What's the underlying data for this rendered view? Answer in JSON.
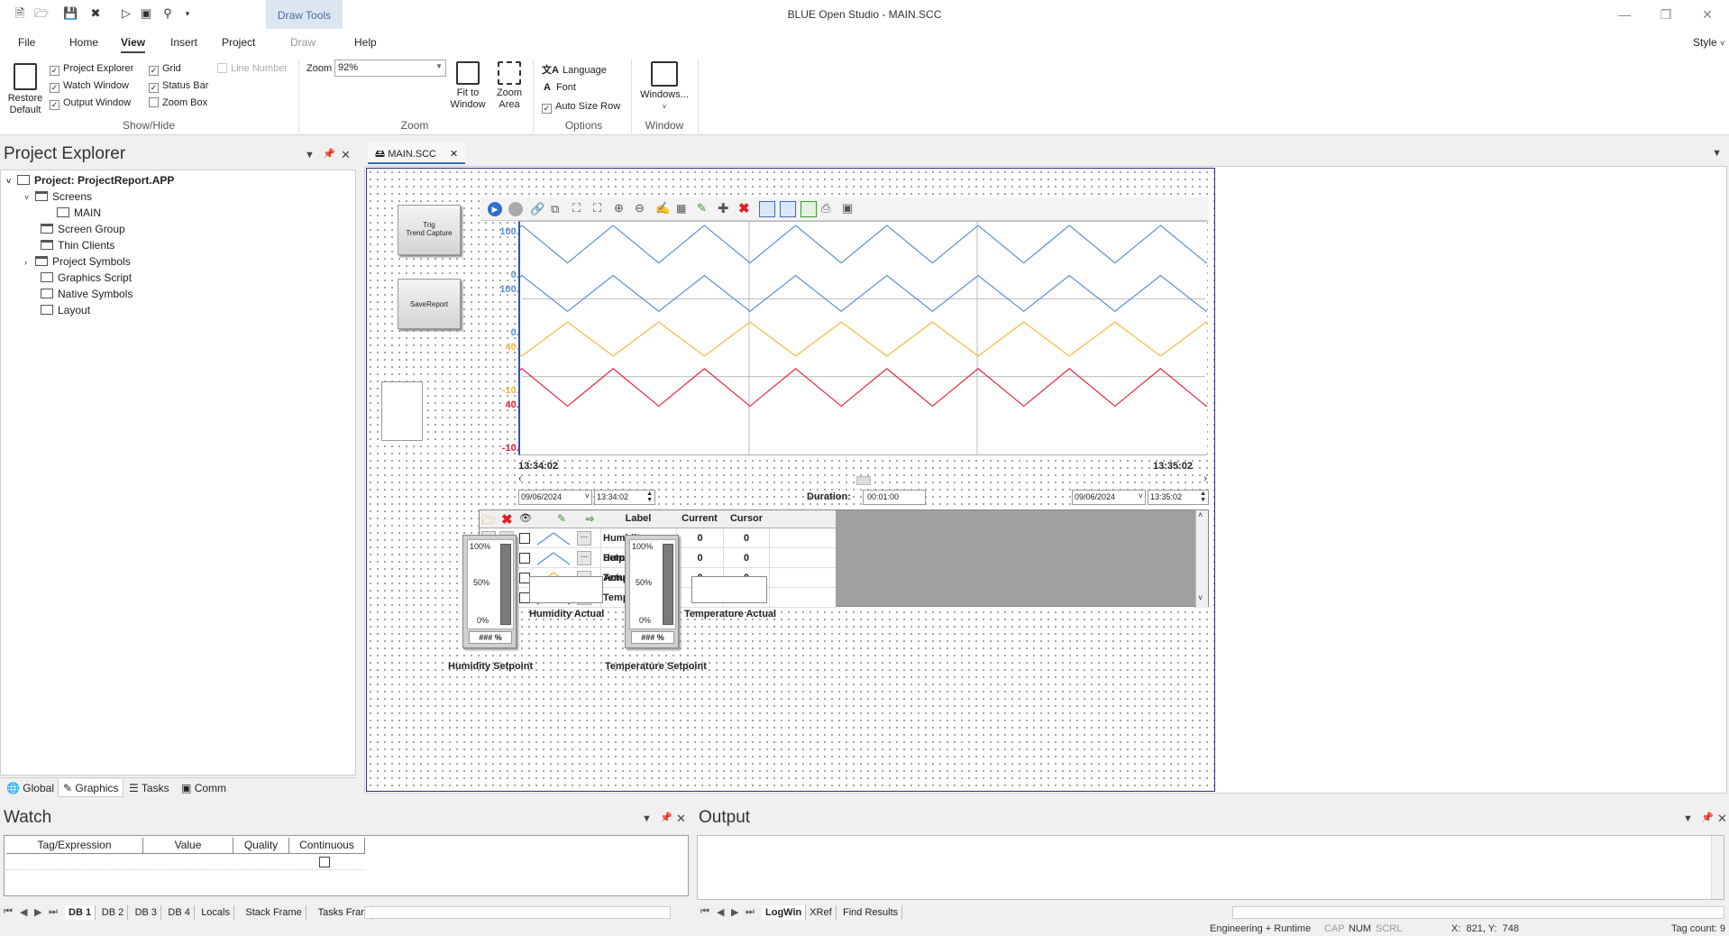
{
  "app": {
    "title": "BLUE Open Studio - MAIN.SCC",
    "contextual_tab": "Draw Tools"
  },
  "ribbon_tabs": [
    "File",
    "Home",
    "View",
    "Insert",
    "Project",
    "Draw",
    "Help"
  ],
  "style_label": "Style",
  "ribbon": {
    "restore_default": "Restore\nDefault",
    "show_hide": {
      "label": "Show/Hide",
      "items": [
        {
          "label": "Project Explorer",
          "checked": true,
          "enabled": true
        },
        {
          "label": "Watch Window",
          "checked": true,
          "enabled": true
        },
        {
          "label": "Output Window",
          "checked": true,
          "enabled": true
        },
        {
          "label": "Grid",
          "checked": true,
          "enabled": true
        },
        {
          "label": "Status Bar",
          "checked": true,
          "enabled": true
        },
        {
          "label": "Zoom Box",
          "checked": false,
          "enabled": true
        },
        {
          "label": "Line Number",
          "checked": false,
          "enabled": false
        }
      ]
    },
    "zoom": {
      "label": "Zoom",
      "field_label": "Zoom",
      "value": "92%",
      "fit_to_window": "Fit to\nWindow",
      "zoom_area": "Zoom\nArea"
    },
    "options": {
      "label": "Options",
      "language": "Language",
      "font": "Font",
      "auto_size_row": "Auto Size Row",
      "auto_size_checked": true
    },
    "window": {
      "label": "Window",
      "windows_btn": "Windows..."
    }
  },
  "explorer": {
    "title": "Project Explorer",
    "tree": [
      {
        "label": "Project: ProjectReport.APP",
        "level": 0,
        "expanded": true,
        "bold": true
      },
      {
        "label": "Screens",
        "level": 1,
        "expanded": true
      },
      {
        "label": "MAIN",
        "level": 2
      },
      {
        "label": "Screen Group",
        "level": 1
      },
      {
        "label": "Thin Clients",
        "level": 1
      },
      {
        "label": "Project Symbols",
        "level": 1,
        "collapsed": true
      },
      {
        "label": "Graphics Script",
        "level": 1
      },
      {
        "label": "Native Symbols",
        "level": 1
      },
      {
        "label": "Layout",
        "level": 1
      }
    ],
    "bottom_tabs": [
      "Global",
      "Graphics",
      "Tasks",
      "Comm"
    ],
    "active_bottom_tab": "Graphics"
  },
  "document": {
    "tab_label": "MAIN.SCC"
  },
  "hmi": {
    "btn_trig": "Trig\nTrend Capture",
    "btn_save": "SaveReport",
    "trend": {
      "pens": [
        {
          "name": "Humidity Setpoint",
          "color": "#5b8fd6",
          "max": "100.00",
          "min": "0.00"
        },
        {
          "name": "Humidity Actual",
          "color": "#5b8fd6",
          "max": "100.00",
          "min": "0.00"
        },
        {
          "name": "Temp Setpoint",
          "color": "#f4b942",
          "max": "40.00",
          "min": "-10.00"
        },
        {
          "name": "Temp Actual",
          "color": "#e8213a",
          "max": "40.00",
          "min": "-10.00"
        }
      ],
      "time_start": "13:34:02",
      "time_end": "13:35:02",
      "start_date": "09/06/2024",
      "start_time": "13:34:02",
      "duration_label": "Duration:",
      "duration": "00:01:00",
      "end_date": "09/06/2024",
      "end_time": "13:35:02"
    },
    "legend": {
      "headers": [
        "Label",
        "Current",
        "Cursor"
      ],
      "rows": [
        {
          "label": "Humidity Setpoint",
          "current": "0",
          "cursor": "0",
          "color": "#5b8fd6"
        },
        {
          "label": "Humidity Actual",
          "current": "0",
          "cursor": "0",
          "color": "#5b8fd6"
        },
        {
          "label": "Temp Setpoint",
          "current": "0",
          "cursor": "0",
          "color": "#f4b942"
        },
        {
          "label": "Temp Actual",
          "current": "0",
          "cursor": "0",
          "color": "#e8213a"
        }
      ]
    },
    "gauges": [
      {
        "scale": [
          "100%",
          "50%",
          "0%"
        ],
        "readout": "### %",
        "caption": "Humidity Setpoint"
      },
      {
        "scale": [
          "100%",
          "50%",
          "0%"
        ],
        "readout": "### %",
        "caption": "Temperature Setpoint"
      }
    ],
    "display_captions": [
      "Humidity Actual",
      "Temperature Actual"
    ]
  },
  "watch": {
    "title": "Watch",
    "columns": [
      "Tag/Expression",
      "Value",
      "Quality",
      "Continuous"
    ],
    "tabs": [
      "DB 1",
      "DB 2",
      "DB 3",
      "DB 4",
      "Locals",
      "Stack Frame",
      "Tasks Fram"
    ]
  },
  "output": {
    "title": "Output",
    "tabs": [
      "LogWin",
      "XRef",
      "Find Results"
    ]
  },
  "status": {
    "mode": "Engineering + Runtime",
    "caps": "CAP",
    "num": "NUM",
    "scrl": "SCRL",
    "coords": "X:  821, Y:  748",
    "tag_count": "Tag count: 9"
  }
}
